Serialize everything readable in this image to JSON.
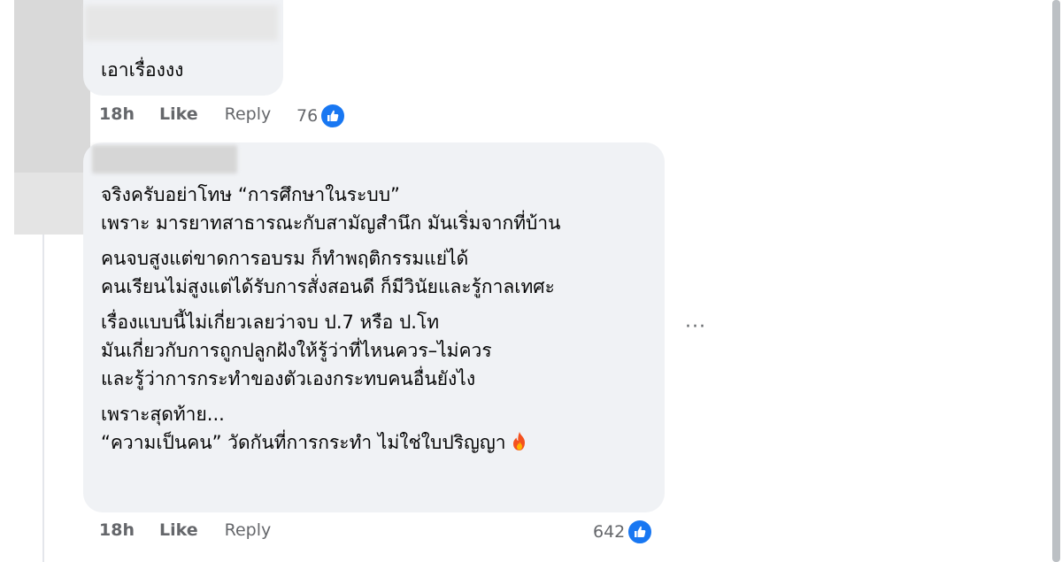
{
  "comment1": {
    "text": "เอาเรื่องงง",
    "time": "18h",
    "like_label": "Like",
    "reply_label": "Reply",
    "reaction_count": "76"
  },
  "comment2": {
    "paragraphs": [
      [
        "จริงครับอย่าโทษ “การศึกษาในระบบ”",
        "เพราะ มารยาทสาธารณะกับสามัญสำนึก มันเริ่มจากที่บ้าน"
      ],
      [
        "คนจบสูงแต่ขาดการอบรม ก็ทำพฤติกรรมแย่ได้",
        "คนเรียนไม่สูงแต่ได้รับการสั่งสอนดี ก็มีวินัยและรู้กาลเทศะ"
      ],
      [
        "เรื่องแบบนี้ไม่เกี่ยวเลยว่าจบ ป.7 หรือ ป.โท",
        "มันเกี่ยวกับการถูกปลูกฝังให้รู้ว่าที่ไหนควร–ไม่ควร",
        "และรู้ว่าการกระทำของตัวเองกระทบคนอื่นยังไง"
      ],
      [
        "เพราะสุดท้าย...",
        "“ความเป็นคน” วัดกันที่การกระทำ ไม่ใช่ใบปริญญา"
      ]
    ],
    "time": "18h",
    "like_label": "Like",
    "reply_label": "Reply",
    "reaction_count": "642",
    "more_label": "···"
  },
  "icons": {
    "like_reaction": "like-icon",
    "fire": "fire-icon"
  },
  "colors": {
    "bubble": "#f0f2f5",
    "like_blue": "#1877f2",
    "meta_text": "#65676b"
  }
}
